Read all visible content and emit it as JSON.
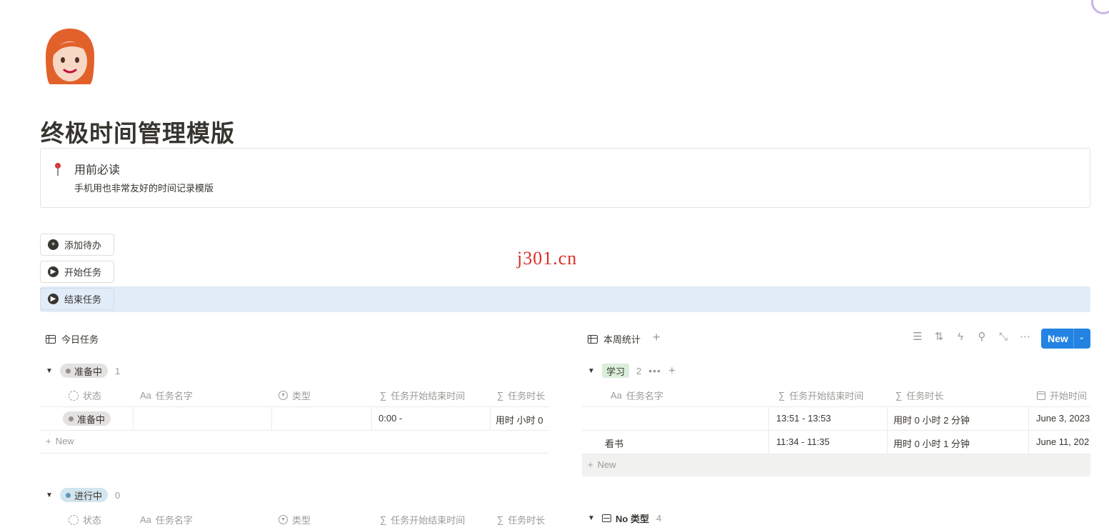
{
  "page": {
    "title": "终极时间管理模版",
    "avatar_icon": "woman-red-hair-avatar"
  },
  "callout": {
    "icon": "pushpin-icon",
    "title": "用前必读",
    "body": "手机用也非常友好的时间记录模版"
  },
  "buttons": {
    "add_todo": "添加待办",
    "start_task": "开始任务",
    "end_task": "结束任务"
  },
  "watermark": "j301.cn",
  "left_view": {
    "tab_label": "今日任务",
    "columns": [
      "状态",
      "任务名字",
      "类型",
      "任务开始结束时间",
      "任务时长"
    ],
    "groups": [
      {
        "label": "准备中",
        "count": "1",
        "rows": [
          {
            "status": "准备中",
            "name": "",
            "type": "",
            "time_range": "0:00 -",
            "duration": "用时  小时 0"
          }
        ],
        "new_label": "New"
      },
      {
        "label": "进行中",
        "count": "0"
      }
    ]
  },
  "right_view": {
    "tab_label": "本周统计",
    "new_button": "New",
    "columns": [
      "任务名字",
      "任务开始结束时间",
      "任务时长",
      "开始时间"
    ],
    "groups": [
      {
        "label": "学习",
        "count": "2",
        "rows": [
          {
            "name": "",
            "time_range": "13:51 - 13:53",
            "duration": "用时 0 小时 2 分钟",
            "start": "June 3, 2023"
          },
          {
            "name": "看书",
            "time_range": "11:34 - 11:35",
            "duration": "用时 0 小时 1 分钟",
            "start": "June 11, 202"
          }
        ],
        "new_label": "New"
      },
      {
        "label": "No 类型",
        "count": "4"
      }
    ]
  },
  "colors": {
    "accent": "#2383e2",
    "action_row_bg": "#e1ecf8",
    "watermark": "#d9302a",
    "tag_green": "#dbeddb",
    "tag_blue": "#d3e5ef",
    "tag_grey": "#e3e2e0"
  }
}
